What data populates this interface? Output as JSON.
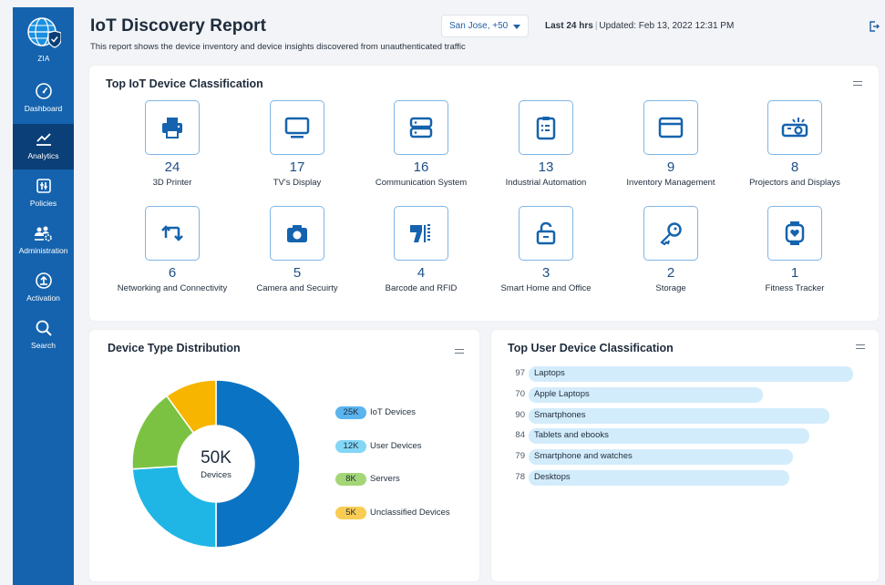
{
  "sidebar": {
    "logo_label": "ZIA",
    "items": [
      {
        "label": "Dashboard",
        "icon": "speedometer-icon"
      },
      {
        "label": "Analytics",
        "icon": "line-chart-icon"
      },
      {
        "label": "Policies",
        "icon": "policy-icon"
      },
      {
        "label": "Administration",
        "icon": "users-gear-icon"
      },
      {
        "label": "Activation",
        "icon": "upload-icon"
      },
      {
        "label": "Search",
        "icon": "search-icon"
      }
    ],
    "active_item": "Analytics"
  },
  "header": {
    "title": "IoT Discovery Report",
    "subtitle": "This report shows the device inventory and device insights discovered from unauthenticated traffic",
    "location_filter": "San Jose, +50",
    "time_range": "Last 24 hrs",
    "updated": "Updated: Feb 13, 2022 12:31 PM"
  },
  "classification": {
    "title": "Top IoT Device Classification",
    "tiles": [
      {
        "count": "24",
        "label": "3D Printer",
        "icon": "printer-icon"
      },
      {
        "count": "17",
        "label": "TV's Display",
        "icon": "monitor-icon"
      },
      {
        "count": "16",
        "label": "Communication System",
        "icon": "server-icon"
      },
      {
        "count": "13",
        "label": "Industrial Automation",
        "icon": "clipboard-icon"
      },
      {
        "count": "9",
        "label": "Inventory Management",
        "icon": "window-icon"
      },
      {
        "count": "8",
        "label": "Projectors and Displays",
        "icon": "projector-icon"
      },
      {
        "count": "6",
        "label": "Networking and Connectivity",
        "icon": "network-arrows-icon"
      },
      {
        "count": "5",
        "label": "Camera and Secuirty",
        "icon": "camera-icon"
      },
      {
        "count": "4",
        "label": "Barcode and RFID",
        "icon": "barcode-scanner-icon"
      },
      {
        "count": "3",
        "label": "Smart Home and Office",
        "icon": "unlock-icon"
      },
      {
        "count": "2",
        "label": "Storage",
        "icon": "key-icon"
      },
      {
        "count": "1",
        "label": "Fitness Tracker",
        "icon": "smartwatch-icon"
      }
    ]
  },
  "distribution": {
    "title": "Device Type Distribution",
    "center_value": "50K",
    "center_label": "Devices",
    "segments": [
      {
        "value": "25K",
        "label": "IoT Devices",
        "amount": 25,
        "color": "#0b73c4",
        "pill": "#5ab4ee"
      },
      {
        "value": "12K",
        "label": "User Devices",
        "amount": 12,
        "color": "#1fb6e6",
        "pill": "#83d6f5"
      },
      {
        "value": "8K",
        "label": "Servers",
        "amount": 8,
        "color": "#7cc242",
        "pill": "#a4d677"
      },
      {
        "value": "5K",
        "label": "Unclassified Devices",
        "amount": 5,
        "color": "#f7b500",
        "pill": "#f9cc54"
      }
    ]
  },
  "user_devices": {
    "title": "Top User Device Classification",
    "rows": [
      {
        "value": 97,
        "label": "Laptops"
      },
      {
        "value": 70,
        "label": "Apple Laptops"
      },
      {
        "value": 90,
        "label": "Smartphones"
      },
      {
        "value": 84,
        "label": "Tablets and ebooks"
      },
      {
        "value": 79,
        "label": "Smartphone and watches"
      },
      {
        "value": 78,
        "label": "Desktops"
      }
    ]
  }
}
